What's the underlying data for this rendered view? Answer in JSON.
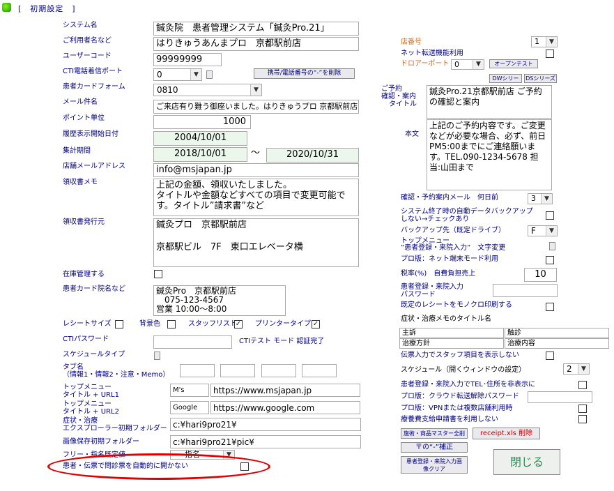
{
  "window": {
    "title": "[　初期設定　]"
  },
  "left": {
    "system_name": {
      "label": "システム名",
      "value": "鍼灸院　患者管理システム「鍼灸Pro.21」"
    },
    "user_name": {
      "label": "ご利用者名など",
      "value": "はりきゅうあんまプロ　京都駅前店"
    },
    "user_code": {
      "label": "ユーザーコード",
      "value": "99999999"
    },
    "cti_port": {
      "label": "CTI電話着信ポート",
      "value": "0",
      "delete_btn": "携帯/電話番号の“-”を削除"
    },
    "card_form": {
      "label": "患者カードフォーム",
      "value": "0810"
    },
    "mail_subject": {
      "label": "メール件名",
      "value": "ご来店有り難う御座いました。はりきゅうプロ 京都駅前店"
    },
    "point_unit": {
      "label": "ポイント単位",
      "value": "1000"
    },
    "history_start": {
      "label": "履歴表示開始日付",
      "value": "2004/10/01"
    },
    "period": {
      "label": "集計期間",
      "from": "2018/10/01",
      "sep": "～",
      "to": "2020/10/31"
    },
    "shop_mail": {
      "label": "店舗メールアドレス",
      "value": "info@msjapan.jp"
    },
    "receipt_memo": {
      "label": "領収書メモ",
      "value": "上記の金額、領収いたしました。\nタイトルや金額などすべての項目で変更可能です。タイトル”請求書”など"
    },
    "receipt_issuer": {
      "label": "領収書発行元",
      "value": "鍼灸プロ　京都駅前店\n\n京都駅ビル　7F　東口エレベータ横"
    },
    "stock": {
      "label": "在庫管理する"
    },
    "card_clinic": {
      "label": "患者カード院名など",
      "value": "鍼灸Pro　京都駅前店\n　075-123-4567\n営業 10:00～8:00"
    },
    "receipt_size": {
      "label": "レシートサイズ"
    },
    "bg_color": {
      "label": "背景色"
    },
    "staff_list": {
      "label": "スタッフリスト",
      "checked": "✓"
    },
    "printer_type": {
      "label": "プリンタータイプ",
      "checked": "✓"
    },
    "cti_password": {
      "label": "CTIパスワード",
      "test_btn": "CTIテスト モード 認証完了"
    },
    "schedule_type": {
      "label": "スケジュールタイプ"
    },
    "tab_name": {
      "label1": "タブ名",
      "label2": "（情報1・情報2・注意・Memo）"
    },
    "url1": {
      "label1": "トップメニュー",
      "label2": "タイトル + URL1",
      "title": "M's",
      "url": "https://www.msjapan.jp"
    },
    "url2": {
      "label1": "トップメニュー",
      "label2": "タイトル + URL2",
      "title": "Google",
      "url": "https://www.google.com"
    },
    "explorer": {
      "label1": "症状・治療",
      "label2": "エクスプローラー初期フォルダー",
      "value": "c:¥hari9pro21¥"
    },
    "image_folder": {
      "label": "画像保存初期フォルダー",
      "value": "c:¥hari9pro21¥pic¥"
    },
    "free_item": {
      "label": "フリー・指名既定値",
      "value": "指名"
    },
    "auto_open": {
      "label": "患者・伝票で問診票を自動的に開かない"
    }
  },
  "right": {
    "shop_no": {
      "label": "店番号",
      "value": "1"
    },
    "net_transfer": {
      "label": "ネット転送機能利用"
    },
    "drawer_port": {
      "label": "ドロアーポート",
      "value": "0",
      "open_test": "オープンテスト"
    },
    "dw_series": "DWシリーズ",
    "ds_series": "DSシリーズ",
    "reserve_title": {
      "label1": "ご予約",
      "label2": "確認・案内",
      "label3": "タイトル",
      "value": "鍼灸Pro.21京都駅前店 ご予約の確認と案内"
    },
    "body": {
      "label": "本文",
      "value": "上記のご予約内容です。ご変更などが必要な場合、必ず、前日PM5:00までにご連絡願います。TEL.090-1234-5678 担当:山田まで"
    },
    "reserve_days": {
      "label": "確認・予約案内メール　何日前",
      "value": "3"
    },
    "auto_backup": {
      "label1": "システム終了時の自動データバックアップ",
      "label2": "しない→チェックあり"
    },
    "backup_drive": {
      "label": "バックアップ先（既定ドライブ）",
      "value": "F"
    },
    "top_menu": {
      "label1": "トップメニュー",
      "label2": "”患者登録・来院入力”　文字変更"
    },
    "pro_net": {
      "label": "プロ版：ネット端末モード利用"
    },
    "tax": {
      "label": "税率(%)　自費負担売上",
      "value": "10"
    },
    "patient_pw": {
      "label1": "患者登録・来院入力",
      "label2": "パスワード"
    },
    "mono_print": {
      "label": "既定のレシートをモノクロ印刷する"
    },
    "memo_title": {
      "label": "症状・治療メモのタイトル名"
    },
    "memo_grid": [
      "主訴",
      "触診",
      "治療方針",
      "治療内容"
    ],
    "no_staff": {
      "label": "伝票入力でスタッフ項目を表示しない"
    },
    "schedule_window": {
      "label": "スケジュール（開くウィンドウの設定）",
      "value": "2"
    },
    "hide_tel": {
      "label": "患者登録・来院入力でTEL･住所を非表示に"
    },
    "cloud_pw": {
      "label": "プロ版：クラウド転送解除パスワード"
    },
    "vpn": {
      "label": "プロ版：VPNまたは複数店舗利用時"
    },
    "medical_form": {
      "label": "療養費支給申請書を利用しない"
    },
    "master_delete": "施術・商品マスター全削除",
    "receipt_delete": "receipt.xls 削除",
    "fix_dash": "〒の“-”補正",
    "clear_image": "患者登録・来院入力画像クリア",
    "close": "閉じる"
  },
  "colors": {
    "label": "#000080",
    "accent": "#d2691e",
    "highlight": "#eaf7ea",
    "close_text": "#2e8b57",
    "annotation": "#e00000"
  }
}
